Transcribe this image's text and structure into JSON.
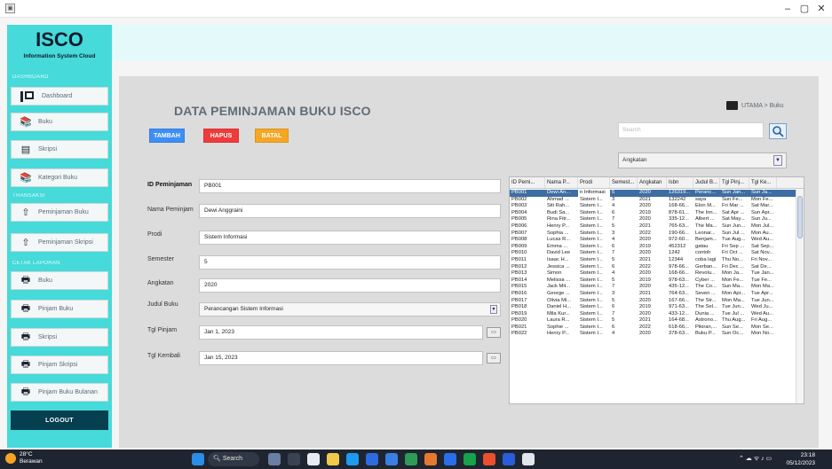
{
  "window": {
    "icon": "app-window-icon",
    "min": "–",
    "max": "▢",
    "close": "✕"
  },
  "sidebar": {
    "brand": "ISCO",
    "brand_sub": "Information System Cloud",
    "section1": "DASHBOARD",
    "section2": "TRANSAKSI",
    "section3": "CETAK LAPORAN",
    "items": [
      {
        "label": "Dashboard",
        "icon": "dashboard-icon"
      },
      {
        "label": "Buku",
        "icon": "book-icon"
      },
      {
        "label": "Skripsi",
        "icon": "document-icon"
      },
      {
        "label": "Kategori Buku",
        "icon": "category-icon"
      },
      {
        "label": "Peminjaman Buku",
        "icon": "upload-icon"
      },
      {
        "label": "Peminjaman Skripsi",
        "icon": "upload-icon"
      },
      {
        "label": "Buku",
        "icon": "printer-icon"
      },
      {
        "label": "Pinjam Buku",
        "icon": "printer-icon"
      },
      {
        "label": "Skripsi",
        "icon": "printer-icon"
      },
      {
        "label": "Pinjam Skripsi",
        "icon": "printer-icon"
      },
      {
        "label": "Pinjam Buku Bulanan",
        "icon": "printer-icon"
      }
    ],
    "logout": "LOGOUT",
    "accent": "#46dada"
  },
  "header": {
    "title": "DATA PEMINJAMAN BUKU ISCO",
    "breadcrumb": "UTAMA > Buku",
    "buttons": {
      "tambah": "TAMBAH",
      "hapus": "HAPUS",
      "batal": "BATAL"
    },
    "colors": {
      "tambah": "#3d8ef5",
      "hapus": "#ef3b3b",
      "batal": "#f5a623"
    }
  },
  "search": {
    "placeholder": "Search",
    "filter": "Angkatan"
  },
  "form": {
    "id_label": "ID Peminjaman",
    "id_value": "PB001",
    "nama_label": "Nama Peminjam",
    "nama_value": "Dewi Anggraini",
    "prodi_label": "Prodi",
    "prodi_value": "Sistem Informasi",
    "semester_label": "Semester",
    "semester_value": "5",
    "angkatan_label": "Angkatan",
    "angkatan_value": "2020",
    "judul_label": "Judul Buku",
    "judul_value": "Perancangan Sistem Informasi",
    "tgl_pinjam_label": "Tgl Pinjam",
    "tgl_pinjam_value": "Jan 1, 2023",
    "tgl_kembali_label": "Tgl Kembali",
    "tgl_kembali_value": "Jan 15, 2023"
  },
  "table": {
    "columns": [
      "ID Pemi...",
      "Nama P...",
      "Prodi",
      "Semest...",
      "Angkatan",
      "Isbn",
      "Judul B...",
      "Tgl Pinj...",
      "Tgl Ke..."
    ],
    "rows": [
      [
        "PB001",
        "Dewi An...",
        "n Informasi",
        "5",
        "2020",
        "126319...",
        "Peranc...",
        "Sun Jan...",
        "Sun Ja..."
      ],
      [
        "PB002",
        "Ahmad ...",
        "Sistem I...",
        "3",
        "2021",
        "132242",
        "saya",
        "Sun Fe...",
        "Mon Fe..."
      ],
      [
        "PB003",
        "Siti Rah...",
        "Sistem I...",
        "4",
        "2020",
        "168-66...",
        "Elon M...",
        "Fri Mar ...",
        "Sat Mar..."
      ],
      [
        "PB004",
        "Budi Sa...",
        "Sistem I...",
        "6",
        "2019",
        "878-61...",
        "The Inn...",
        "Sat Apr ...",
        "Sun Apr..."
      ],
      [
        "PB005",
        "Rina Fitr...",
        "Sistem I...",
        "7",
        "2020",
        "335-12...",
        "Albert ...",
        "Sat May...",
        "Sun Ju..."
      ],
      [
        "PB006",
        "Henry P...",
        "Sistem I...",
        "5",
        "2021",
        "765-63...",
        "The Ma...",
        "Sun Jun...",
        "Mon Jul..."
      ],
      [
        "PB007",
        "Sophia ...",
        "Sistem I...",
        "3",
        "2022",
        "190-66...",
        "Leonar...",
        "Sun Jul ...",
        "Mon Au..."
      ],
      [
        "PB008",
        "Lucas R...",
        "Sistem I...",
        "4",
        "2020",
        "972-60...",
        "Benjam...",
        "Tue Aug...",
        "Wed Au..."
      ],
      [
        "PB009",
        "Emma ...",
        "Sistem I...",
        "6",
        "2019",
        "452312",
        "gatau",
        "Fri Sep ...",
        "Sat Sep..."
      ],
      [
        "PB010",
        "David Lee",
        "Sistem I...",
        "7",
        "2020",
        "1242",
        "contoh",
        "Fri Oct ...",
        "Sat Nov..."
      ],
      [
        "PB011",
        "Isaac H...",
        "Sistem I...",
        "5",
        "2021",
        "12344",
        "coba lagi",
        "Thu No...",
        "Fri Nov..."
      ],
      [
        "PB012",
        "Jessica ...",
        "Sistem I...",
        "6",
        "2022",
        "978-66...",
        "Gerban...",
        "Fri Dec ...",
        "Sat De..."
      ],
      [
        "PB013",
        "Simon",
        "Sistem I...",
        "4",
        "2020",
        "168-66...",
        "Revolu...",
        "Mon Ja...",
        "Tue Jan..."
      ],
      [
        "PB014",
        "Melissa ...",
        "Sistem I...",
        "5",
        "2019",
        "978-63...",
        "Cyber ...",
        "Mon Fe...",
        "Tue Fe..."
      ],
      [
        "PB015",
        "Jack Mit...",
        "Sistem I...",
        "7",
        "2020",
        "435-12...",
        "The Co...",
        "Sun Ma...",
        "Mon Ma..."
      ],
      [
        "PB016",
        "George ...",
        "Sistem I...",
        "3",
        "2021",
        "764-63...",
        "Seven ...",
        "Mon Apr...",
        "Tue Apr..."
      ],
      [
        "PB017",
        "Olivia Mi...",
        "Sistem I...",
        "5",
        "2020",
        "167-66...",
        "The Str...",
        "Mon Ma...",
        "Tue Jun..."
      ],
      [
        "PB018",
        "Daniel H...",
        "Sistem I...",
        "6",
        "2019",
        "971-63...",
        "The Sel...",
        "Tue Jun...",
        "Wed Ju..."
      ],
      [
        "PB019",
        "Mila Kur...",
        "Sistem I...",
        "7",
        "2020",
        "433-12...",
        "Dunia ...",
        "Tue Jul ...",
        "Wed Au..."
      ],
      [
        "PB020",
        "Laura R...",
        "Sistem I...",
        "5",
        "2021",
        "164-68...",
        "Astrono...",
        "Thu Aug...",
        "Fri Aug..."
      ],
      [
        "PB021",
        "Sophie ...",
        "Sistem I...",
        "6",
        "2022",
        "618-66...",
        "Pikiran,...",
        "Sun Se...",
        "Mon Se..."
      ],
      [
        "PB022",
        "Henry P...",
        "Sistem I...",
        "4",
        "2020",
        "378-63...",
        "Buku P...",
        "Sun Oc...",
        "Mon No..."
      ]
    ]
  },
  "taskbar": {
    "temp": "28°C",
    "weather": "Berawan",
    "search": "Search",
    "time": "23:18",
    "date": "05/12/2023"
  }
}
